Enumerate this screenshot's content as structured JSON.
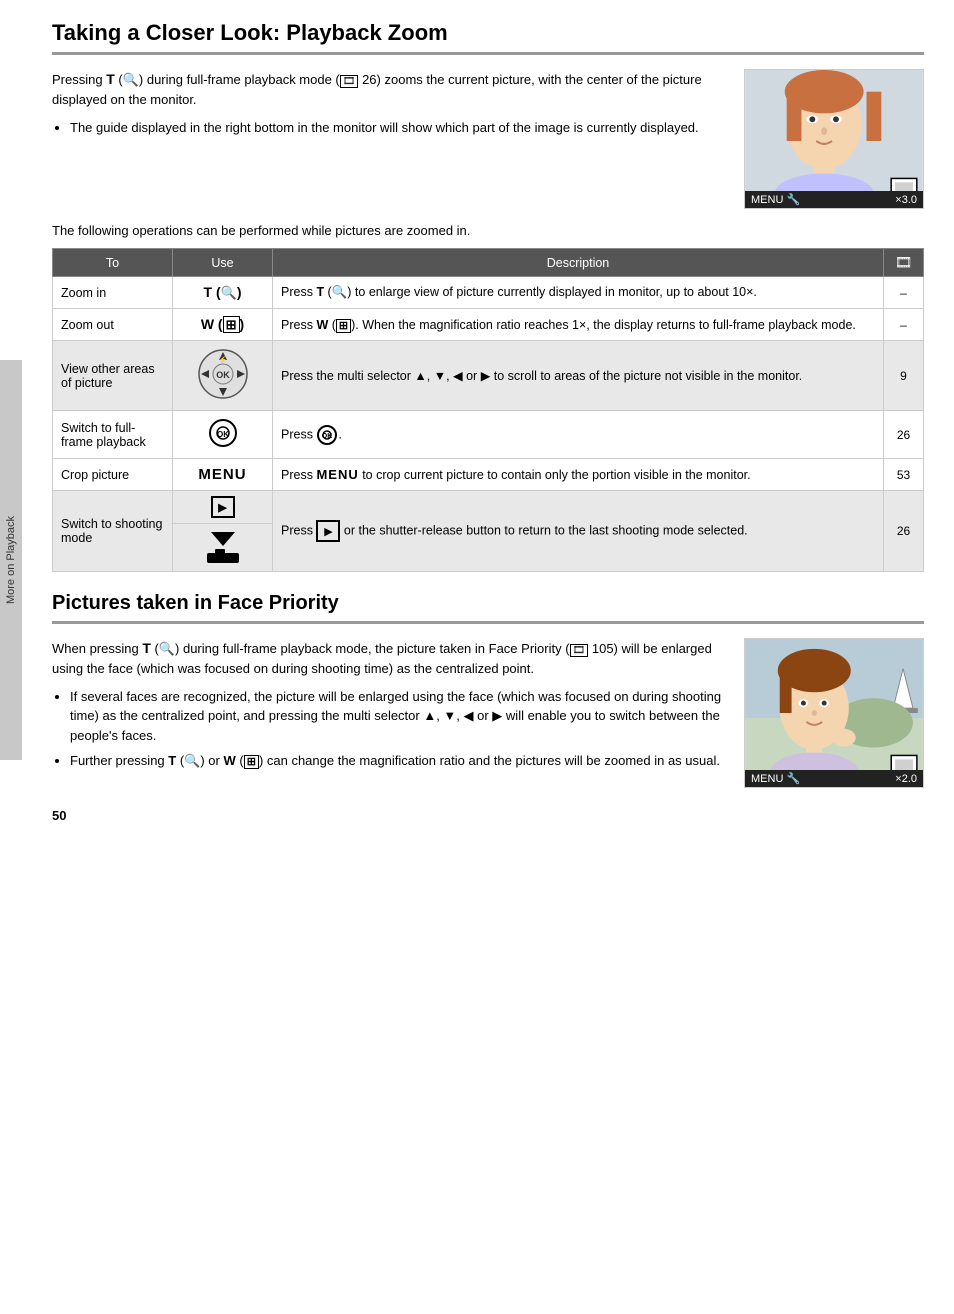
{
  "sidebar": {
    "label": "More on Playback"
  },
  "page_number": "50",
  "section1": {
    "title": "Taking a Closer Look: Playback Zoom",
    "intro": {
      "para1_before": "Pressing ",
      "T_key": "T",
      "para1_mid": " (",
      "q_symbol": "Q",
      "para1_after": ") during full-frame playback mode (",
      "ref1": "26",
      "para1_end": ") zooms the current picture, with the center of the picture displayed on the monitor.",
      "bullet1": "The guide displayed in the right bottom in the monitor will show which part of the image is currently displayed."
    },
    "operations_note": "The following operations can be performed while pictures are zoomed in.",
    "table": {
      "headers": [
        "To",
        "Use",
        "Description",
        ""
      ],
      "rows": [
        {
          "to": "Zoom in",
          "use": "T (Q)",
          "use_bold": true,
          "description": "Press T (Q) to enlarge view of picture currently displayed in monitor, up to about 10×.",
          "ref": "–"
        },
        {
          "to": "Zoom out",
          "use": "W (⊞)",
          "use_bold": true,
          "description": "Press W (⊞). When the magnification ratio reaches 1×, the display returns to full-frame playback mode.",
          "ref": "–"
        },
        {
          "to": "View other areas of picture",
          "use": "multi-selector",
          "description": "Press the multi selector ▲, ▼, ◀ or ▶ to scroll to areas of the picture not visible in the monitor.",
          "ref": "9",
          "shaded": true
        },
        {
          "to": "Switch to full-frame playback",
          "use": "ok-button",
          "description": "Press ⊙.",
          "ref": "26"
        },
        {
          "to": "Crop picture",
          "use": "MENU",
          "description": "Press MENU to crop current picture to contain only the portion visible in the monitor.",
          "ref": "53"
        },
        {
          "to": "Switch to shooting mode",
          "use_split": true,
          "use_top": "play-icon",
          "use_bottom": "shoot-icon",
          "description": "Press ▶ or the shutter-release button to return to the last shooting mode selected.",
          "ref": "26",
          "shaded": true
        }
      ]
    }
  },
  "section2": {
    "title": "Pictures taken in Face Priority",
    "para1_before": "When pressing ",
    "T_key": "T",
    "para1_mid": " (",
    "q_sym": "Q",
    "para1_after": ") during full-frame playback mode, the picture taken in Face Priority (",
    "ref1": "105",
    "para1_end": ") will be enlarged using the face (which was focused on during shooting time) as the centralized point.",
    "bullets": [
      "If several faces are recognized, the picture will be enlarged using the face (which was focused on during shooting time) as the centralized point, and pressing the multi selector ▲, ▼, ◀ or ▶  will enable you to switch between the people's faces.",
      "Further pressing T (Q) or W (⊞) can change the magnification ratio and the pictures will be zoomed in as usual."
    ]
  }
}
